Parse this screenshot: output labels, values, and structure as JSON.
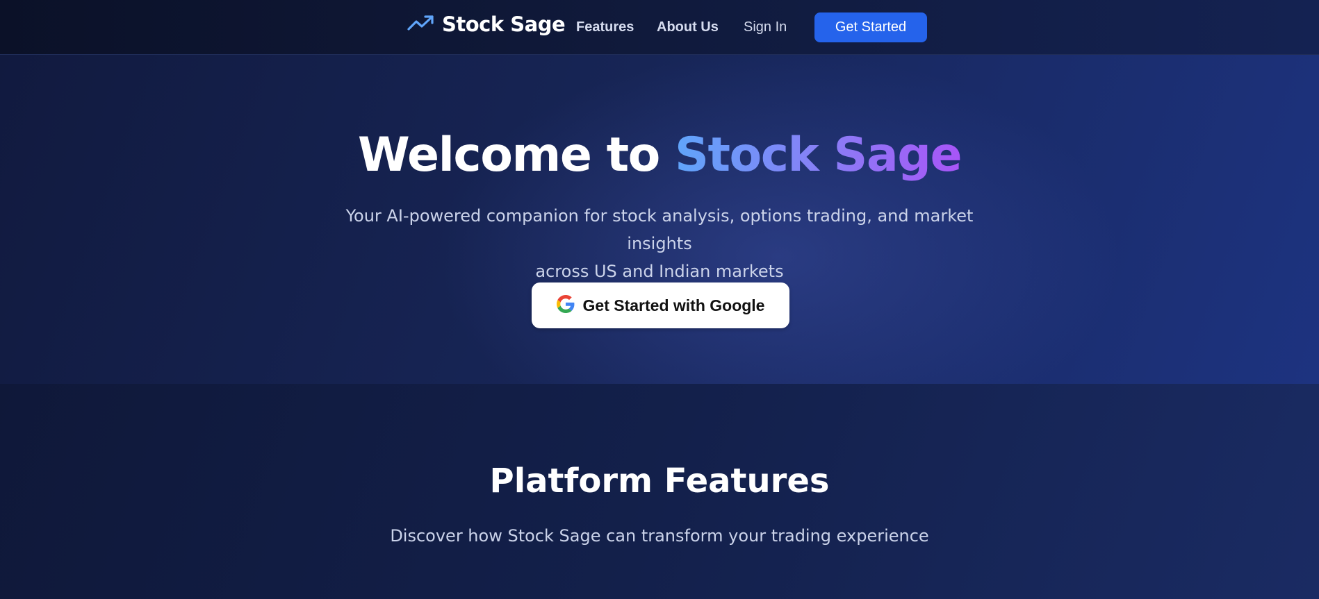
{
  "nav": {
    "brand_name": "Stock Sage",
    "brand_icon": "trending-up-icon",
    "links": [
      "Features",
      "About Us",
      "Sign In"
    ],
    "cta_label": "Get Started",
    "cta_color": "#2563eb"
  },
  "hero": {
    "title_prefix": "Welcome to ",
    "title_accent": "Stock Sage",
    "subtitle_line1": "Your AI-powered companion for stock analysis, options trading, and market insights",
    "subtitle_line2": "across US and Indian markets",
    "google_button_label": "Get Started with Google",
    "google_icon": "google-icon",
    "accent_gradient": [
      "#60a5fa",
      "#a855f7"
    ]
  },
  "features": {
    "title": "Platform Features",
    "subtitle": "Discover how Stock Sage can transform your trading experience"
  }
}
